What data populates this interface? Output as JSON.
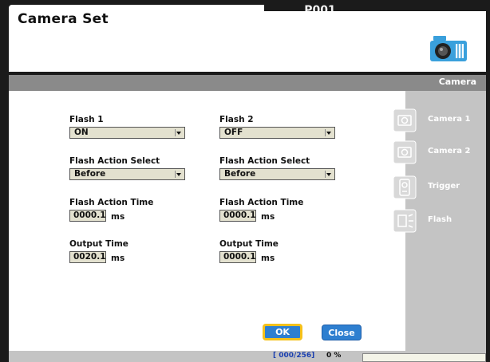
{
  "header": {
    "title": "Camera Set",
    "page_id": "P001"
  },
  "section_bar": {
    "label": "Camera"
  },
  "form": {
    "col1": {
      "flash_label": "Flash 1",
      "flash_value": "ON",
      "action_select_label": "Flash Action Select",
      "action_select_value": "Before",
      "action_time_label": "Flash Action Time",
      "action_time_value": "0000.1",
      "output_time_label": "Output Time",
      "output_time_value": "0020.1"
    },
    "col2": {
      "flash_label": "Flash 2",
      "flash_value": "OFF",
      "action_select_label": "Flash Action Select",
      "action_select_value": "Before",
      "action_time_label": "Flash Action Time",
      "action_time_value": "0000.1",
      "output_time_label": "Output Time",
      "output_time_value": "0000.1"
    },
    "unit": "ms"
  },
  "buttons": {
    "ok": "OK",
    "close": "Close"
  },
  "sidebar": {
    "items": [
      {
        "label": "Camera 1",
        "icon": "camera-icon"
      },
      {
        "label": "Camera 2",
        "icon": "camera-icon"
      },
      {
        "label": "Trigger",
        "icon": "trigger-icon"
      },
      {
        "label": "Flash",
        "icon": "flash-icon"
      }
    ]
  },
  "status": {
    "counter": "[ 000/256]",
    "percent": "0 %"
  },
  "colors": {
    "accent": "#2e7fd0",
    "focus_border": "#f5c11a",
    "field_bg": "#e3e1cf",
    "sidebar_bg": "#c4c4c4",
    "frame": "#1b1b1b"
  }
}
